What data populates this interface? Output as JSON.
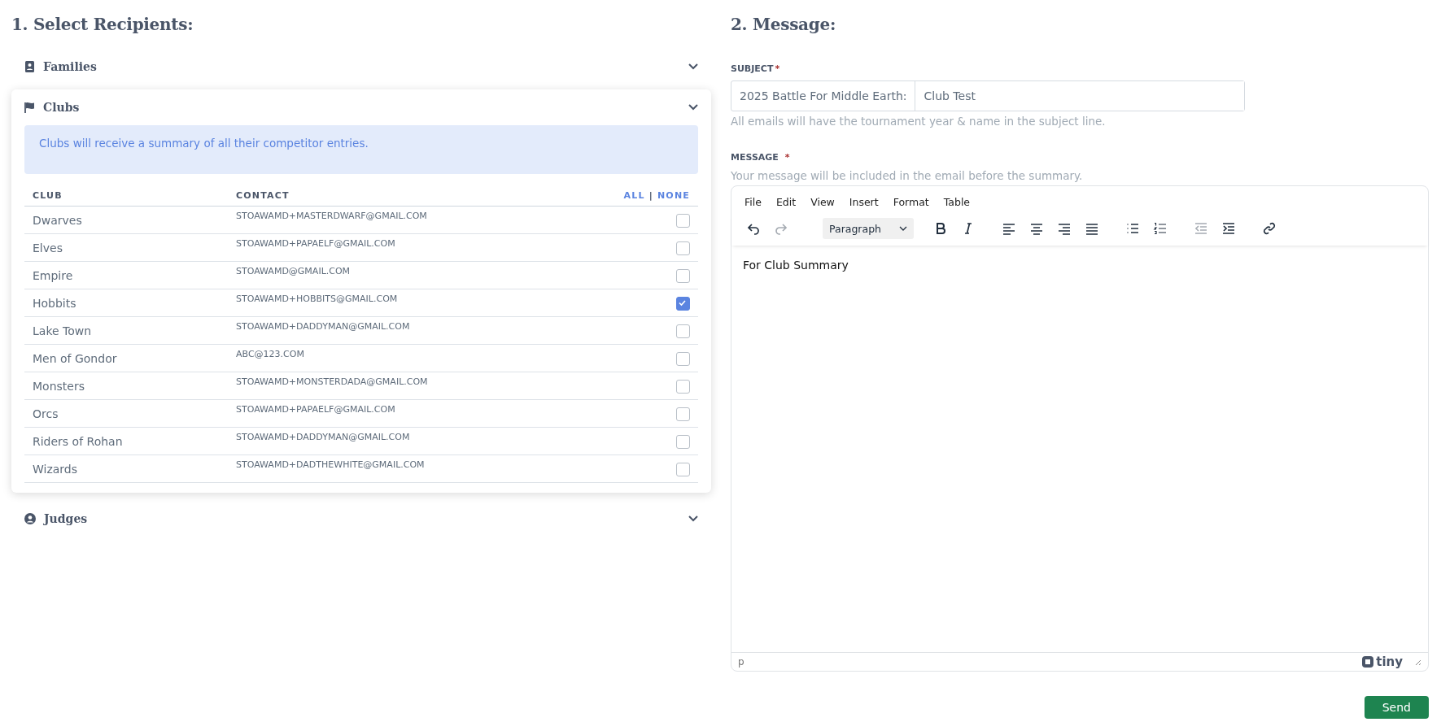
{
  "recipients": {
    "heading": "1. Select Recipients:",
    "sections": [
      {
        "kind": "families",
        "title": "Families",
        "expanded": false
      },
      {
        "kind": "clubs",
        "title": "Clubs",
        "expanded": true,
        "notice": "Clubs will receive a summary of all their competitor entries.",
        "table": {
          "columns": [
            "CLUB",
            "CONTACT"
          ],
          "select_all": "ALL",
          "separator": "|",
          "select_none": "NONE",
          "rows": [
            {
              "club": "Dwarves",
              "contact": "STOAWAMD+MASTERDWARF@GMAIL.COM",
              "checked": false
            },
            {
              "club": "Elves",
              "contact": "STOAWAMD+PAPAELF@GMAIL.COM",
              "checked": false
            },
            {
              "club": "Empire",
              "contact": "STOAWAMD@GMAIL.COM",
              "checked": false
            },
            {
              "club": "Hobbits",
              "contact": "STOAWAMD+HOBBITS@GMAIL.COM",
              "checked": true
            },
            {
              "club": "Lake Town",
              "contact": "STOAWAMD+DADDYMAN@GMAIL.COM",
              "checked": false
            },
            {
              "club": "Men of Gondor",
              "contact": "ABC@123.COM",
              "checked": false
            },
            {
              "club": "Monsters",
              "contact": "STOAWAMD+MONSTERDADA@GMAIL.COM",
              "checked": false
            },
            {
              "club": "Orcs",
              "contact": "STOAWAMD+PAPAELF@GMAIL.COM",
              "checked": false
            },
            {
              "club": "Riders of Rohan",
              "contact": "STOAWAMD+DADDYMAN@GMAIL.COM",
              "checked": false
            },
            {
              "club": "Wizards",
              "contact": "STOAWAMD+DADTHEWHITE@GMAIL.COM",
              "checked": false
            }
          ]
        }
      },
      {
        "kind": "judges",
        "title": "Judges",
        "expanded": false
      }
    ]
  },
  "message": {
    "heading": "2. Message:",
    "subject": {
      "label": "SUBJECT",
      "required_mark": "*",
      "prefix": "2025 Battle For Middle Earth:",
      "value": "Club Test",
      "help": "All emails will have the tournament year & name in the subject line."
    },
    "body": {
      "label": "MESSAGE",
      "required_mark": "*",
      "help": "Your message will be included in the email before the summary."
    },
    "editor": {
      "menu": [
        "File",
        "Edit",
        "View",
        "Insert",
        "Format",
        "Table"
      ],
      "toolbar": [
        {
          "kind": "undo",
          "disabled": false
        },
        {
          "kind": "redo",
          "disabled": true
        },
        {
          "kind": "select",
          "value": "Paragraph"
        },
        {
          "kind": "bold",
          "disabled": false
        },
        {
          "kind": "italic",
          "disabled": false
        },
        {
          "kind": "align-left",
          "disabled": false
        },
        {
          "kind": "align-center",
          "disabled": false
        },
        {
          "kind": "align-right",
          "disabled": false
        },
        {
          "kind": "justify",
          "disabled": false
        },
        {
          "kind": "bullets",
          "disabled": false
        },
        {
          "kind": "numbers",
          "disabled": false
        },
        {
          "kind": "outdent",
          "disabled": true
        },
        {
          "kind": "indent",
          "disabled": false
        },
        {
          "kind": "link",
          "disabled": false
        }
      ],
      "content": "For Club Summary",
      "path": "p",
      "brand": "tiny"
    },
    "send": "Send"
  }
}
